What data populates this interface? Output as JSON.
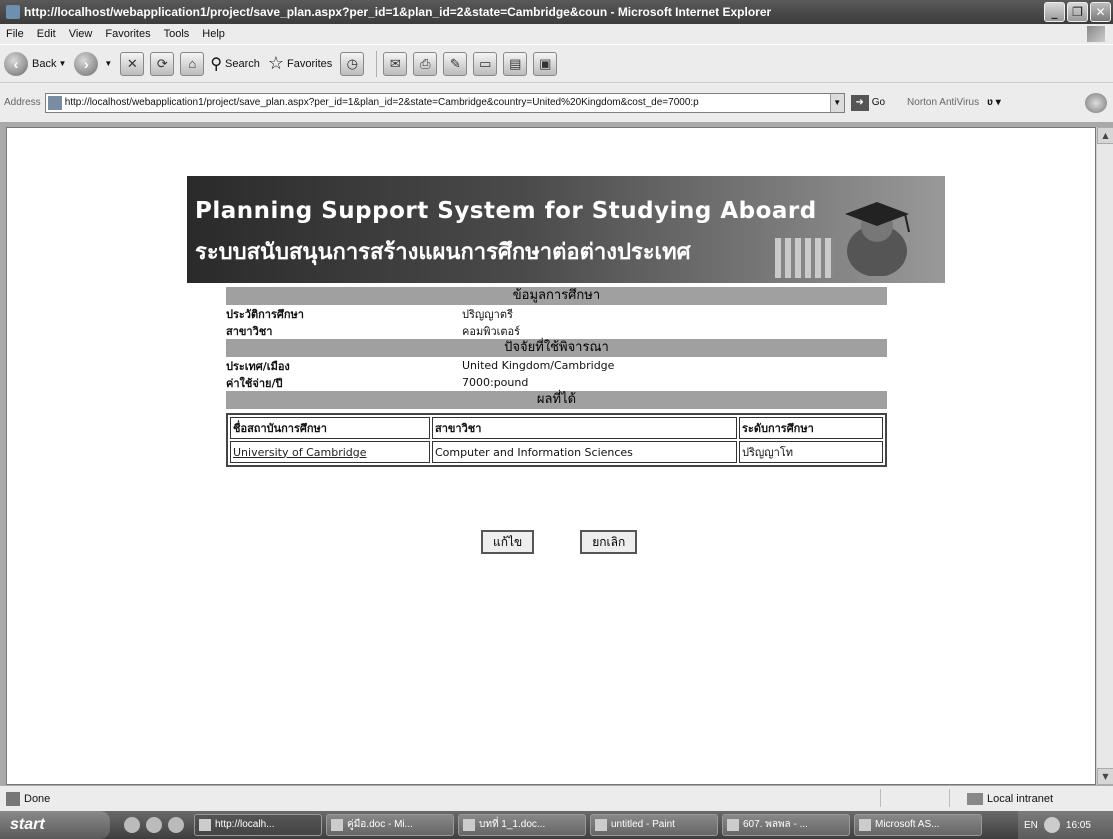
{
  "window": {
    "title": "http://localhost/webapplication1/project/save_plan.aspx?per_id=1&plan_id=2&state=Cambridge&coun - Microsoft Internet Explorer"
  },
  "menu": [
    "File",
    "Edit",
    "View",
    "Favorites",
    "Tools",
    "Help"
  ],
  "toolbar": {
    "back_label": "Back",
    "search_label": "Search",
    "favorites_label": "Favorites"
  },
  "address": {
    "label": "Address",
    "url": "http://localhost/webapplication1/project/save_plan.aspx?per_id=1&plan_id=2&state=Cambridge&country=United%20Kingdom&cost_de=7000:p",
    "go_label": "Go",
    "norton_label": "Norton AntiVirus"
  },
  "banner": {
    "title_en": "Planning Support System for Studying Aboard",
    "title_th": "ระบบสนับสนุนการสร้างแผนการศึกษาต่อต่างประเทศ"
  },
  "education": {
    "heading": "ข้อมูลการศึกษา",
    "rows": [
      {
        "label": "ประวัติการศึกษา",
        "value": "ปริญญาตรี"
      },
      {
        "label": "สาขาวิชา",
        "value": "คอมพิวเตอร์"
      }
    ]
  },
  "factors": {
    "heading": "ปัจจัยที่ใช้พิจารณา",
    "rows": [
      {
        "label": "ประเทศ/เมือง",
        "value": "United Kingdom/Cambridge"
      },
      {
        "label": "ค่าใช้จ่าย/ปี",
        "value": "7000:pound"
      }
    ]
  },
  "results": {
    "heading": "ผลที่ได้",
    "columns": [
      "ชื่อสถาบันการศึกษา",
      "สาขาวิชา",
      "ระดับการศึกษา"
    ],
    "rows": [
      {
        "institution": "University of Cambridge",
        "field": "Computer and Information Sciences",
        "level": "ปริญญาโท"
      }
    ]
  },
  "buttons": {
    "edit": "แก้ไข",
    "cancel": "ยกเลิก"
  },
  "status": {
    "text": "Done",
    "zone": "Local intranet"
  },
  "taskbar": {
    "start": "start",
    "tasks": [
      "http://localh...",
      "คู่มือ.doc - Mi...",
      "บทที่ 1_1.doc...",
      "untitled - Paint",
      "607. พลพล - ...",
      "Microsoft AS..."
    ],
    "lang": "EN",
    "clock": "16:05"
  }
}
